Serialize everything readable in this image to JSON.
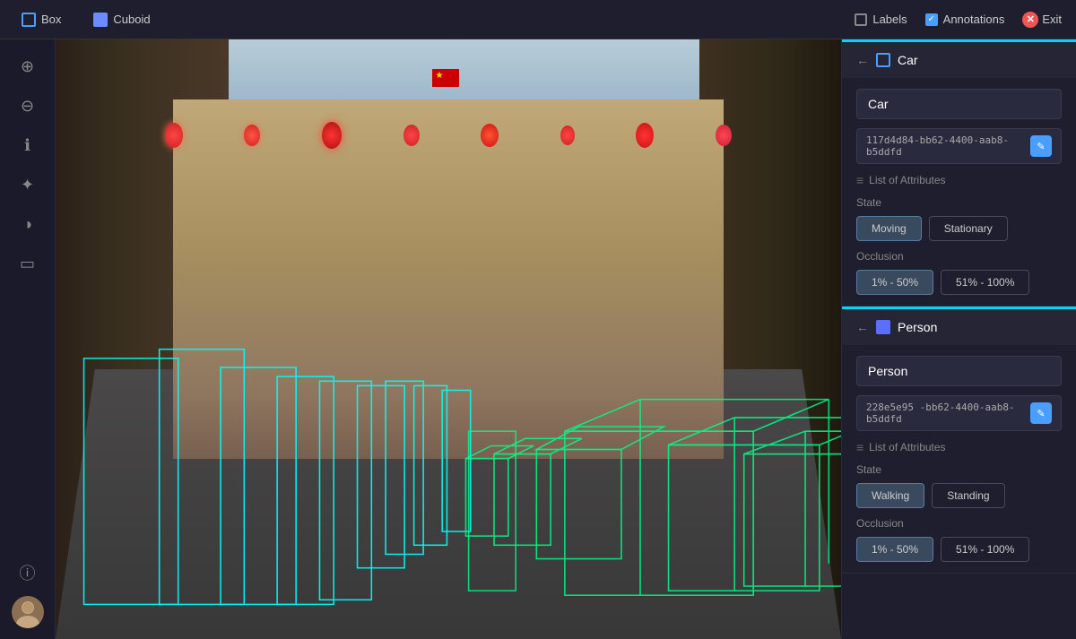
{
  "toolbar": {
    "box_label": "Box",
    "cuboid_label": "Cuboid",
    "labels_label": "Labels",
    "annotations_label": "Annotations",
    "exit_label": "Exit",
    "labels_checked": false,
    "annotations_checked": true
  },
  "sidebar": {
    "icons": [
      {
        "name": "zoom-in-icon",
        "symbol": "🔍"
      },
      {
        "name": "zoom-out-icon",
        "symbol": "🔎"
      },
      {
        "name": "info-icon",
        "symbol": "ℹ"
      },
      {
        "name": "settings-icon",
        "symbol": "⚙"
      },
      {
        "name": "contrast-icon",
        "symbol": "◑"
      },
      {
        "name": "screen-icon",
        "symbol": "⊡"
      },
      {
        "name": "help-icon",
        "symbol": "ⓘ"
      }
    ],
    "avatar_initials": "👤"
  },
  "car_card": {
    "back_label": "←",
    "icon_type": "box",
    "title": "Car",
    "label_value": "Car",
    "id_value": "117d4d84-bb62-4400-aab8-b5ddfd",
    "attributes_label": "List of Attributes",
    "state_label": "State",
    "state_options": [
      {
        "value": "Moving",
        "selected": true
      },
      {
        "value": "Stationary",
        "selected": false
      }
    ],
    "occlusion_label": "Occlusion",
    "occlusion_options": [
      {
        "value": "1% - 50%",
        "selected": true
      },
      {
        "value": "51% - 100%",
        "selected": false
      }
    ]
  },
  "person_card": {
    "back_label": "←",
    "icon_type": "cuboid",
    "title": "Person",
    "label_value": "Person",
    "id_value": "228e5e95 -bb62-4400-aab8-b5ddfd",
    "attributes_label": "List of Attributes",
    "state_label": "State",
    "state_options": [
      {
        "value": "Walking",
        "selected": true
      },
      {
        "value": "Standing",
        "selected": false
      }
    ],
    "occlusion_label": "Occlusion",
    "occlusion_options": [
      {
        "value": "1% - 50%",
        "selected": true
      },
      {
        "value": "51% - 100%",
        "selected": false
      }
    ]
  }
}
